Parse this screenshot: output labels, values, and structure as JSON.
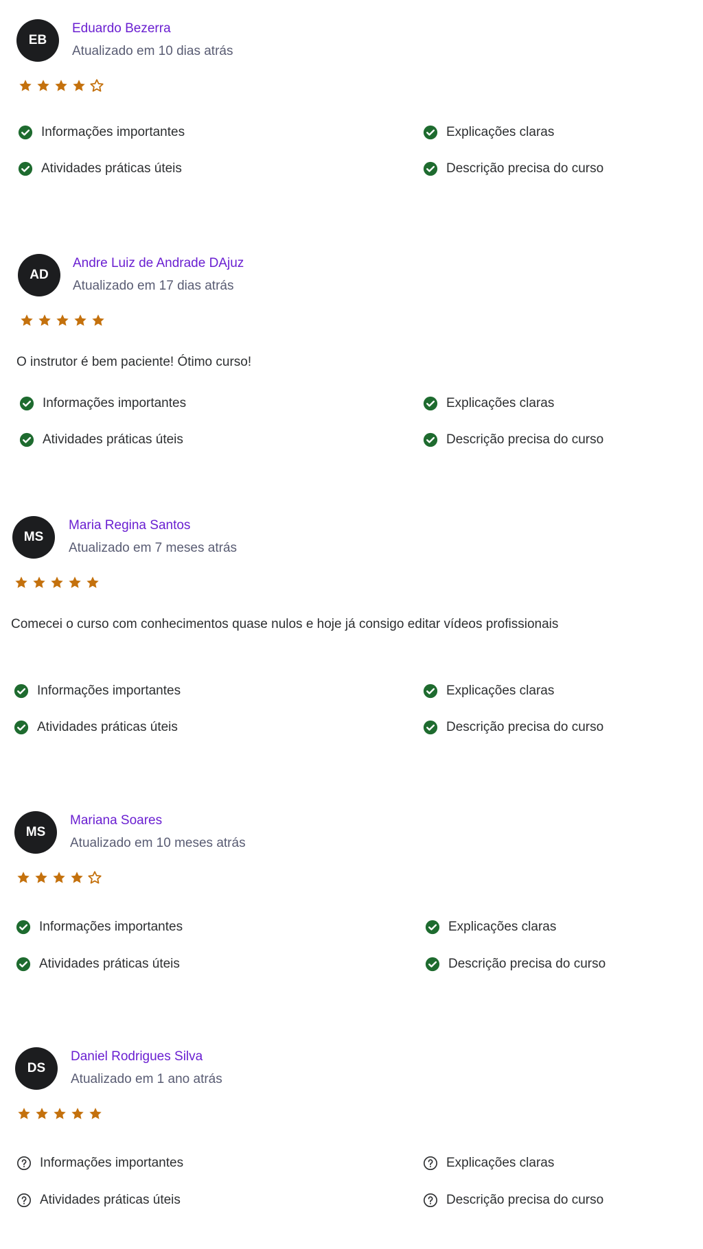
{
  "colors": {
    "avatar_bg": "#1c1d1f",
    "name": "#6a1fd1",
    "meta": "#595c73",
    "star": "#c4710d",
    "check": "#1e6b2f"
  },
  "reviews": [
    {
      "initials": "EB",
      "name": "Eduardo Bezerra",
      "updated": "Atualizado em 10 dias atrás",
      "rating": 4,
      "comment": "",
      "tags": [
        {
          "label": "Informações importantes",
          "status": "check"
        },
        {
          "label": "Explicações claras",
          "status": "check"
        },
        {
          "label": "Atividades práticas úteis",
          "status": "check"
        },
        {
          "label": "Descrição precisa do curso",
          "status": "check"
        }
      ]
    },
    {
      "initials": "AD",
      "name": "Andre Luiz de Andrade DAjuz",
      "updated": "Atualizado em 17 dias atrás",
      "rating": 5,
      "comment": "O instrutor é bem paciente! Ótimo curso!",
      "tags": [
        {
          "label": "Informações importantes",
          "status": "check"
        },
        {
          "label": "Explicações claras",
          "status": "check"
        },
        {
          "label": "Atividades práticas úteis",
          "status": "check"
        },
        {
          "label": "Descrição precisa do curso",
          "status": "check"
        }
      ]
    },
    {
      "initials": "MS",
      "name": "Maria Regina Santos",
      "updated": "Atualizado em 7 meses atrás",
      "rating": 5,
      "comment": "Comecei o curso com conhecimentos quase nulos e hoje já consigo editar vídeos profissionais",
      "tags": [
        {
          "label": "Informações importantes",
          "status": "check"
        },
        {
          "label": "Explicações claras",
          "status": "check"
        },
        {
          "label": "Atividades práticas úteis",
          "status": "check"
        },
        {
          "label": "Descrição precisa do curso",
          "status": "check"
        }
      ]
    },
    {
      "initials": "MS",
      "name": "Mariana Soares",
      "updated": "Atualizado em 10 meses atrás",
      "rating": 4,
      "comment": "",
      "tags": [
        {
          "label": "Informações importantes",
          "status": "check"
        },
        {
          "label": "Explicações claras",
          "status": "check"
        },
        {
          "label": "Atividades práticas úteis",
          "status": "check"
        },
        {
          "label": "Descrição precisa do curso",
          "status": "check"
        }
      ]
    },
    {
      "initials": "DS",
      "name": "Daniel Rodrigues Silva",
      "updated": "Atualizado em 1 ano atrás",
      "rating": 5,
      "comment": "",
      "tags": [
        {
          "label": "Informações importantes",
          "status": "question"
        },
        {
          "label": "Explicações claras",
          "status": "question"
        },
        {
          "label": "Atividades práticas úteis",
          "status": "question"
        },
        {
          "label": "Descrição precisa do curso",
          "status": "question"
        }
      ]
    }
  ]
}
